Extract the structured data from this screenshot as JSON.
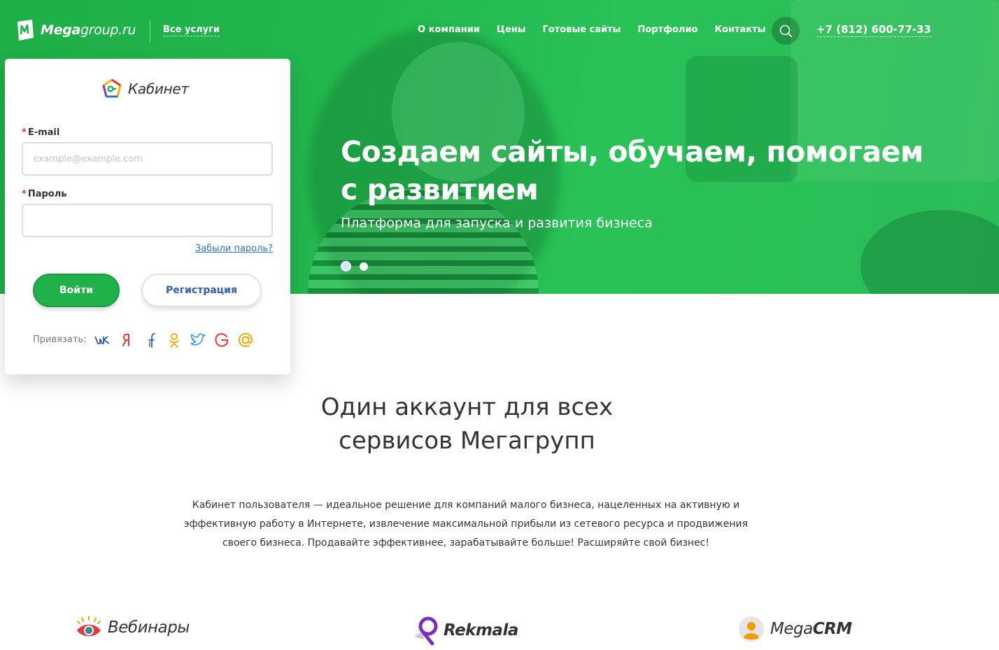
{
  "header": {
    "logo_bold": "Mega",
    "logo_rest": "group.ru",
    "all_services": "Все услуги",
    "nav": [
      "О компании",
      "Цены",
      "Готовые сайты",
      "Портфолио",
      "Контакты"
    ],
    "phone": "+7 (812) 600-77-33"
  },
  "hero": {
    "title": "Создаем сайты, обучаем, помогаем с развитием",
    "subtitle": "Платформа для запуска и развития бизнеса",
    "slides": 2,
    "active_slide": 1
  },
  "login": {
    "brand": "Кабинет",
    "email_label": "E-mail",
    "email_placeholder": "example@example.com",
    "password_label": "Пароль",
    "required_mark": "*",
    "forgot": "Забыли пароль?",
    "login_button": "Войти",
    "register_button": "Регистрация",
    "bind_label": "Привязать:",
    "socials": [
      "vk-icon",
      "yandex-icon",
      "facebook-icon",
      "odnoklassniki-icon",
      "twitter-icon",
      "google-icon",
      "mail-ru-icon"
    ]
  },
  "content": {
    "headline_line1": "Один аккаунт для всех",
    "headline_line2": "сервисов Мегагрупп",
    "description": "Кабинет пользователя — идеальное решение для компаний малого бизнеса, нацеленных на активную и эффективную работу в Интернете, извлечение максимальной прибыли из сетевого ресурса и продвижения своего бизнеса. Продавайте эффективнее, зарабатывайте больше! Расширяйте свой бизнес!"
  },
  "services": {
    "webinars": "Вебинары",
    "rekmala": "Rekmala",
    "megacrm_light": "Mega",
    "megacrm_bold": "CRM"
  },
  "colors": {
    "brand_green": "#21b14b",
    "link_blue": "#2f74c0",
    "register_text": "#2f5fb0",
    "required_red": "#e53935"
  }
}
